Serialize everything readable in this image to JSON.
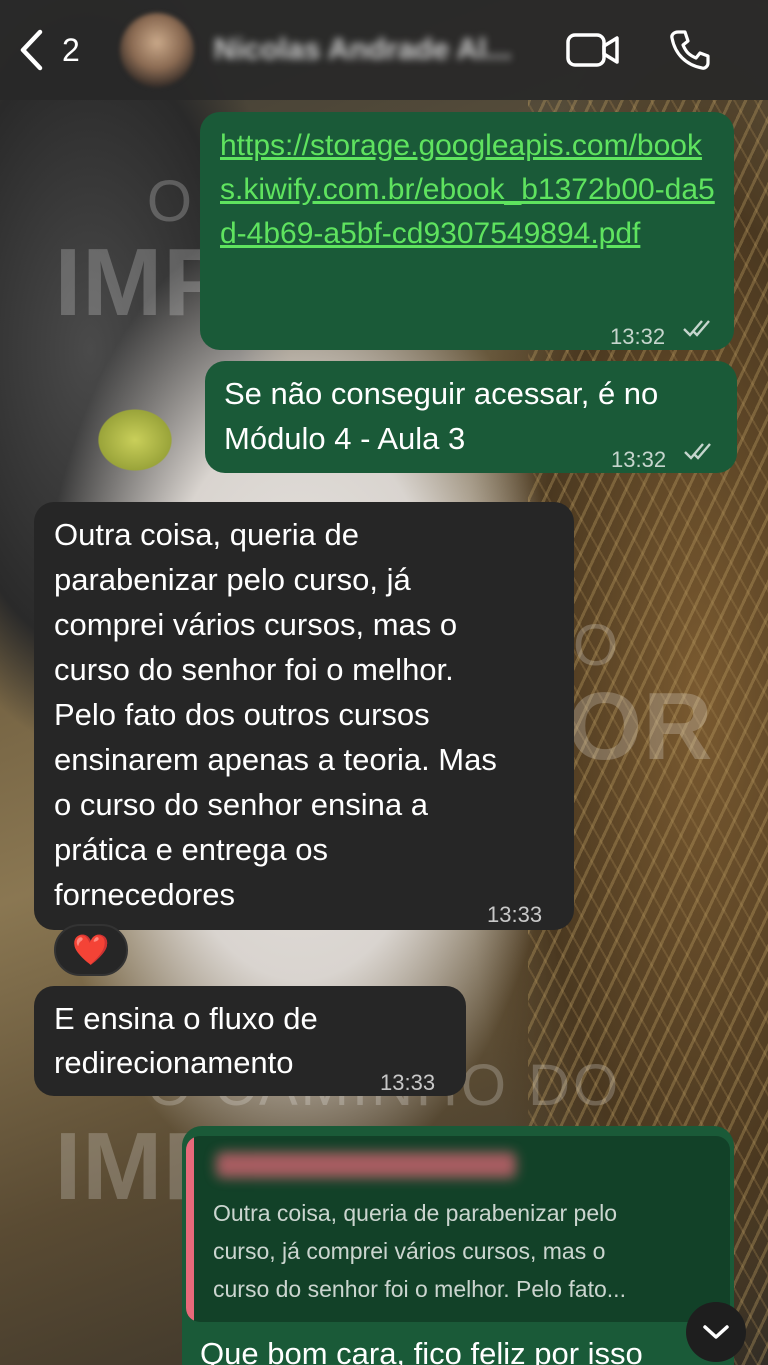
{
  "header": {
    "unread_count": "2",
    "contact_name": "Nicolas Andrade Al..."
  },
  "watermark": {
    "line1": "O CAMINHO DO",
    "line2": "IMPORTADOR"
  },
  "messages": [
    {
      "direction": "outgoing",
      "text": "https://storage.googleapis.com/books.kiwify.com.br/ebook_b1372b00-da5d-4b69-a5bf-cd9307549894.pdf",
      "time": "13:32",
      "status": "read"
    },
    {
      "direction": "outgoing",
      "line1": "Se não conseguir acessar, é no",
      "line2": "Módulo 4 - Aula 3",
      "time": "13:32",
      "status": "read"
    },
    {
      "direction": "incoming",
      "lines": [
        "Outra coisa, queria de",
        "parabenizar pelo curso, já",
        "comprei vários cursos, mas o",
        "curso do senhor foi o melhor.",
        "Pelo fato dos outros cursos",
        "ensinarem apenas a teoria. Mas",
        "o curso do senhor ensina a",
        "prática e entrega os",
        "fornecedores"
      ],
      "time": "13:33",
      "reaction": "❤️"
    },
    {
      "direction": "incoming",
      "line1": "E ensina o fluxo de",
      "line2": "redirecionamento",
      "time": "13:33"
    },
    {
      "direction": "outgoing",
      "quote_lines": [
        "Outra coisa, queria de parabenizar pelo",
        "curso, já comprei vários cursos, mas o",
        "curso do senhor foi o melhor. Pelo fato..."
      ],
      "text": "Que bom cara, fico feliz por isso"
    }
  ],
  "colors": {
    "outgoing_bubble": "#1a5a38",
    "incoming_bubble": "#262626",
    "link": "#5fe35f",
    "quote_bar": "#e8697a"
  },
  "icons": [
    "back-chevron-icon",
    "video-call-icon",
    "phone-icon",
    "read-ticks-icon",
    "chevron-down-icon"
  ]
}
